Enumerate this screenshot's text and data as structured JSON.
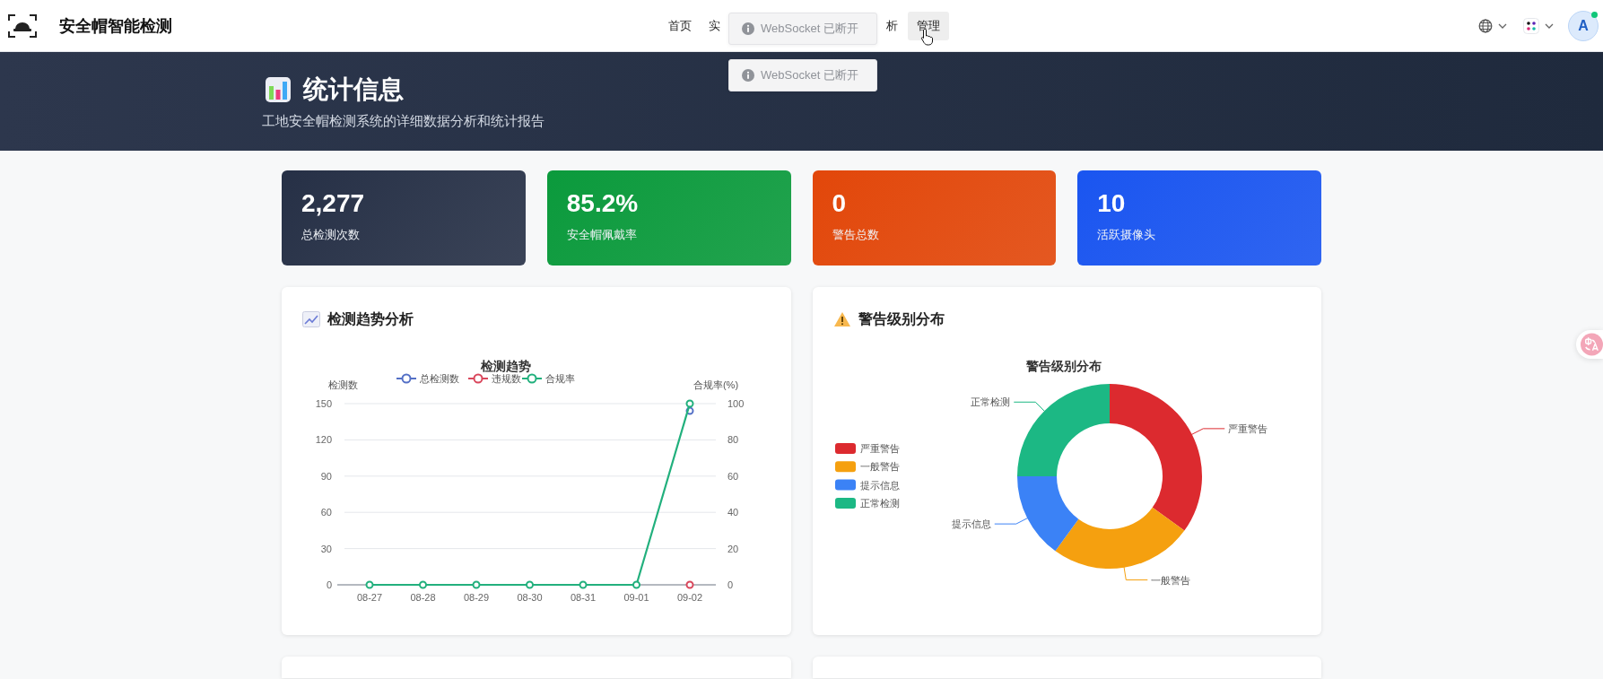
{
  "header": {
    "title": "安全帽智能检测",
    "nav": [
      {
        "label": "首页",
        "selected": false
      },
      {
        "label": "实",
        "selected": false
      },
      {
        "label": "析",
        "selected": false
      },
      {
        "label": "管理",
        "selected": true
      }
    ],
    "avatar": {
      "initial": "A",
      "online": true
    }
  },
  "toasts": [
    {
      "text": "WebSocket 已断开"
    },
    {
      "text": "WebSocket 已断开"
    }
  ],
  "banner": {
    "title": "统计信息",
    "subtitle": "工地安全帽检测系统的详细数据分析和统计报告"
  },
  "stats": [
    {
      "value": "2,277",
      "label": "总检测次数",
      "color": "#263046"
    },
    {
      "value": "85.2%",
      "label": "安全帽佩戴率",
      "color": "#0b9a3c"
    },
    {
      "value": "0",
      "label": "警告总数",
      "color": "#e2470a"
    },
    {
      "value": "10",
      "label": "活跃摄像头",
      "color": "#1a55f0"
    }
  ],
  "trend_card": {
    "title": "检测趋势分析",
    "chart_data": {
      "type": "line",
      "title": "检测趋势",
      "ylabel": "检测数",
      "y2label": "合规率(%)",
      "categories": [
        "08-27",
        "08-28",
        "08-29",
        "08-30",
        "08-31",
        "09-01",
        "09-02"
      ],
      "ylim": [
        0,
        150
      ],
      "yticks": [
        0,
        30,
        60,
        90,
        120,
        150
      ],
      "y2lim": [
        0,
        100
      ],
      "y2ticks": [
        0,
        20,
        40,
        60,
        80,
        100
      ],
      "legend": "top",
      "grid": true,
      "series": [
        {
          "name": "总检测数",
          "color": "#5470c6",
          "marker": true,
          "values": [
            null,
            null,
            null,
            null,
            null,
            null,
            144
          ]
        },
        {
          "name": "违规数",
          "color": "#d9475c",
          "marker": true,
          "values": [
            null,
            null,
            null,
            null,
            null,
            null,
            0
          ]
        },
        {
          "name": "合规率",
          "color": "#22b07d",
          "axis": "y2",
          "marker": true,
          "values": [
            0,
            0,
            0,
            0,
            0,
            0,
            100
          ]
        }
      ]
    }
  },
  "warning_card": {
    "title": "警告级别分布",
    "chart_data": {
      "type": "donut",
      "title": "警告级别分布",
      "categories": [
        "严重警告",
        "一般警告",
        "提示信息",
        "正常检测"
      ],
      "colors": [
        "#dc2a2f",
        "#f5a00f",
        "#3b82f6",
        "#1cb884"
      ],
      "legend": "left",
      "values": [
        35,
        25,
        15,
        25
      ]
    }
  },
  "bottom_cards": [
    {
      "kind": "empty"
    },
    {
      "kind": "empty"
    }
  ]
}
